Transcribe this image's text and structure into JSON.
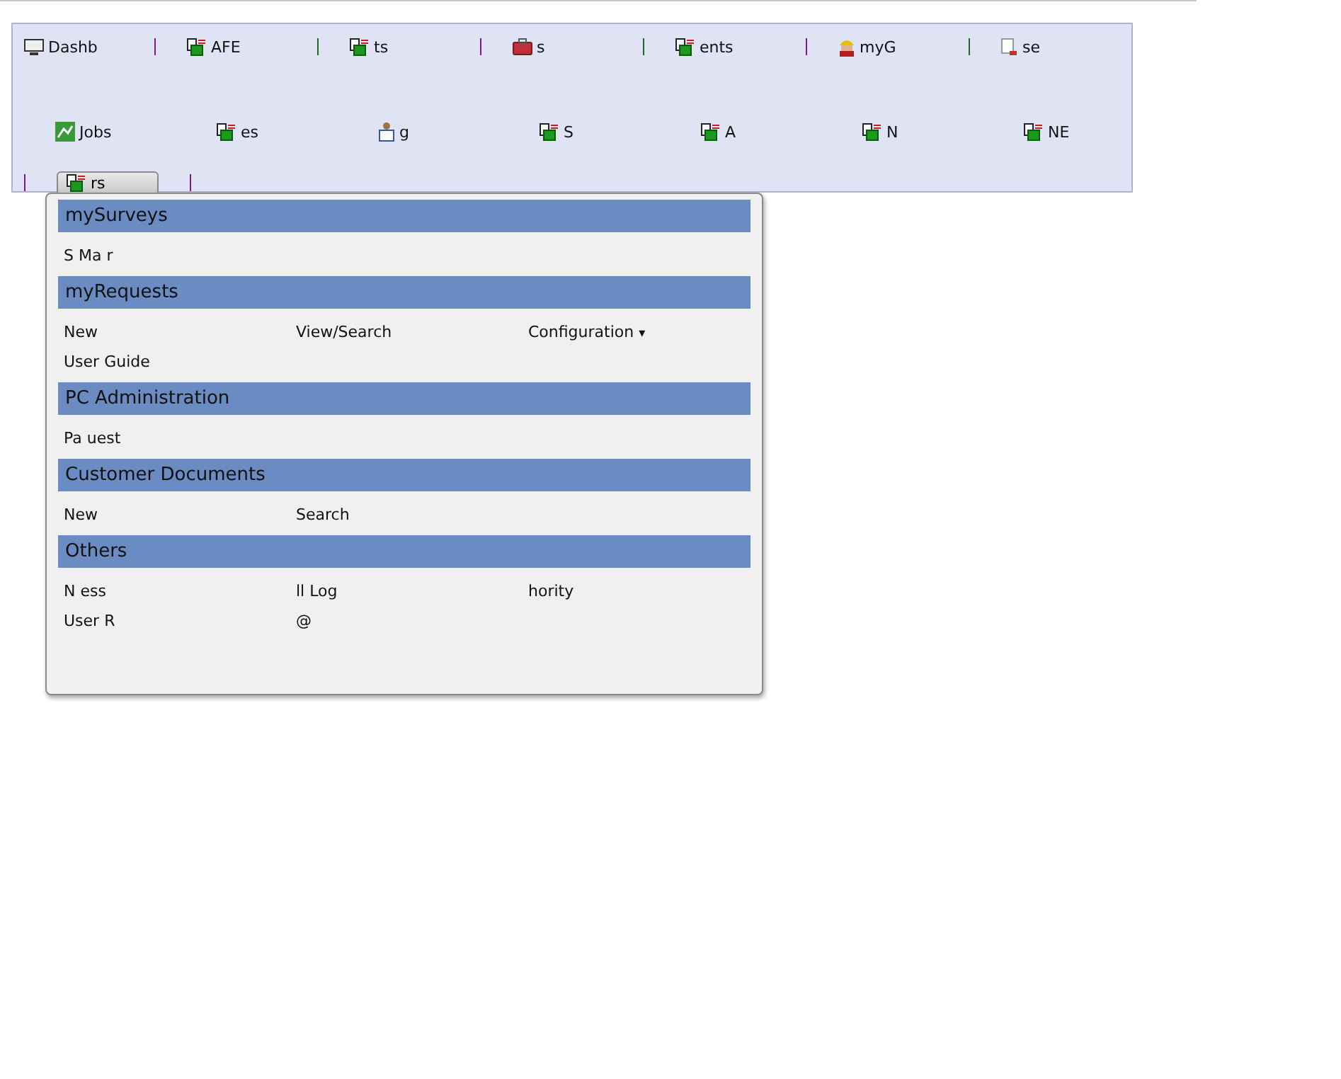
{
  "nav": {
    "rows": [
      [
        {
          "kind": "monitor",
          "label": "Dashb"
        },
        {
          "kind": "doc",
          "label": "AFE"
        },
        {
          "kind": "doc",
          "label": "ts"
        },
        {
          "kind": "briefcase",
          "label": "s"
        },
        {
          "kind": "doc",
          "label": "ents"
        },
        {
          "kind": "worker",
          "label": "myG"
        },
        {
          "kind": "small",
          "label": "se"
        }
      ],
      [
        {
          "kind": "chart",
          "label": "Jobs"
        },
        {
          "kind": "doc",
          "label": "es"
        },
        {
          "kind": "person",
          "label": "g"
        },
        {
          "kind": "doc",
          "label": "S"
        },
        {
          "kind": "doc",
          "label": "A"
        },
        {
          "kind": "doc",
          "label": "N"
        },
        {
          "kind": "doc",
          "label": "NE"
        }
      ],
      [
        {
          "kind": "button",
          "label": "rs",
          "selected": true
        }
      ]
    ]
  },
  "menu": {
    "sections": [
      {
        "title": "mySurveys",
        "items": [
          {
            "label": "S Ma r"
          }
        ]
      },
      {
        "title": "myRequests",
        "items": [
          {
            "label": "New"
          },
          {
            "label": "View/Search"
          },
          {
            "label": "Configuration",
            "caret": "▾"
          },
          {
            "label": "User Guide"
          }
        ]
      },
      {
        "title": "PC Administration",
        "items": [
          {
            "label": "Pa uest"
          }
        ]
      },
      {
        "title": "Customer Documents",
        "items": [
          {
            "label": "New"
          },
          {
            "label": "Search"
          }
        ]
      },
      {
        "title": "Others",
        "items": [
          {
            "label": "N ess"
          },
          {
            "label": "ll Log"
          },
          {
            "label": "hority"
          },
          {
            "label": "User R"
          },
          {
            "label": "@"
          }
        ]
      }
    ]
  }
}
